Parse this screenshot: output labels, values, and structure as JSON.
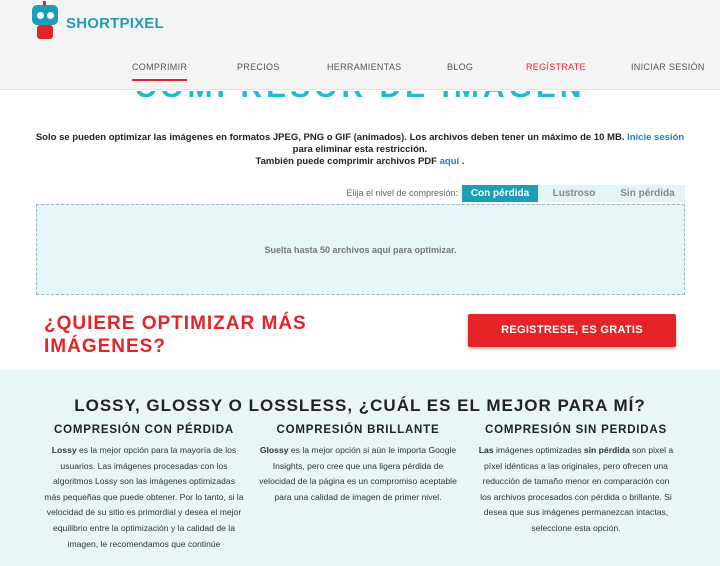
{
  "header": {
    "logo_text_1": "SHORT",
    "logo_text_2": "PIXEL",
    "nav": [
      {
        "label": "COMPRIMIR"
      },
      {
        "label": "PRECIOS"
      },
      {
        "label": "HERRAMIENTAS"
      },
      {
        "label": "BLOG"
      },
      {
        "label": "REGÍSTRATE"
      },
      {
        "label": "INICIAR SESIÓN"
      }
    ]
  },
  "hero": {
    "title": "COMPRESOR DE IMAGEN"
  },
  "info": {
    "line1": "Solo se pueden optimizar las imágenes en formatos JPEG, PNG o GIF (animados). Los archivos deben tener un máximo de 10 MB.",
    "login_link": "Inicie sesión",
    "line2": "para eliminar esta restricción.",
    "line3": "También puede comprimir archivos PDF",
    "pdf_link": "aquí",
    "line3_end": "."
  },
  "compression": {
    "label": "Elija el nivel de compresión:",
    "options": [
      "Con pérdida",
      "Lustroso",
      "Sin pérdida"
    ],
    "selected": "Con pérdida"
  },
  "dropzone": {
    "text": "Suelta hasta 50 archivos aquí para optimizar."
  },
  "cta": {
    "title": "¿QUIERE OPTIMIZAR MÁS IMÁGENES?",
    "button": "REGISTRESE, ES GRATIS"
  },
  "info_section": {
    "title": "LOSSY, GLOSSY O LOSSLESS, ¿CUÁL ES EL MEJOR PARA MÍ?",
    "columns": [
      {
        "title": "COMPRESIÓN CON PÉRDIDA",
        "lead": "Lossy",
        "text": " es la mejor opción para la mayoría de los usuarios. Las imágenes procesadas con los algoritmos Lossy son las imágenes optimizadas más pequeñas que puede obtener. Por lo tanto, si la velocidad de su sitio es primordial y desea el mejor equilibrio entre la optimización y la calidad de la imagen, le recomendamos que continúe"
      },
      {
        "title": "COMPRESIÓN BRILLANTE",
        "lead": "Glossy",
        "text": " es la mejor opción si aún le importa Google Insights, pero cree que una ligera pérdida de velocidad de la página es un compromiso aceptable para una calidad de imagen de primer nivel."
      },
      {
        "title": "COMPRESIÓN SIN PERDIDAS",
        "lead": "Las",
        "text_a": " imágenes optimizadas ",
        "bold_b": "sin pérdida",
        "text_b": " son pixel a píxel idénticas a las originales, pero ofrecen una reducción de tamaño menor en comparación con los archivos procesados con pérdida o brillante. Si desea que sus imágenes permanezcan intactas, seleccione esta opción."
      }
    ]
  },
  "colors": {
    "brand_blue": "#1c9eb7",
    "brand_red": "#e52427",
    "link_blue": "#1c7fc4",
    "panel_bg": "#e8f6f9"
  }
}
